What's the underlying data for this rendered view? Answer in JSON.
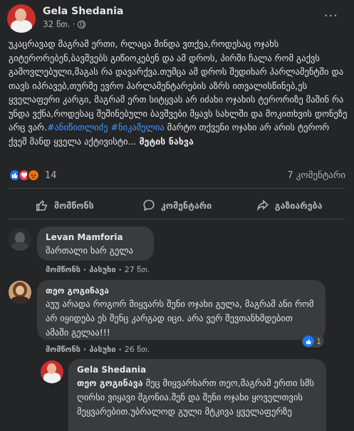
{
  "post": {
    "author": "Gela Shedania",
    "time": "32 წთ.",
    "more_label": "···",
    "text_part1": "უკაცრავად მაგრამ ერთი, რლაცა მინდა ვთქვა,როდესაც ოჯახს გიტერორებენ,ბავშვებს გიწიოკებენ და ამ დროს, პირში ჩალა რომ გაქვს გამოვლებული,მაგას რა დავარქვა.თუმცა ამ დროს შედიხარ პარლამენტში და თავს იპრავებ,თურმე ევრო პარლამენტარების აზრს ითვალისწინებ,ეს ყველაფერი კარგი, მაგრამ ერთ სიტყვას არ იძახი ოჯახის ტერორიზე მაშინ რა უნდა ვქნა,როდესაც შეშინებული ბავშვები მყავს სახლში და მოკითხვის დონეზე არც ვარ.",
    "hashtags": "#ანიწითლიძე #ნიკამელია",
    "text_part2": " მარტო თქვენი ოჯახი არ არის ტერორ ქვეშ მანდ ყველა აქტივისტი...",
    "see_more": "მეტის ნახვა",
    "reaction_count": "14",
    "comment_count": "7 კომენტარი"
  },
  "actions": {
    "like": "მომწონს",
    "comment": "კომენტარი",
    "share": "გაზიარება"
  },
  "comments": [
    {
      "author": "Levan Mamforia",
      "text": "მართალი ხარ გელა",
      "like_label": "მომწონს",
      "reply_label": "პასუხი",
      "time": "27 წთ."
    },
    {
      "author": "თეო გოგინავა",
      "text": "აუუ არადა როგორ მიყვარს შენი ოჯახი გელა, მაგრამ ანი რომ არ იყიდება ეს შენც კარგად იცი. არა ვერ შევთანხმდებით ამაში გელაა!!!",
      "like_label": "მომწონს",
      "reply_label": "პასუხი",
      "time": "26 წთ.",
      "likes": "1"
    },
    {
      "author": "Gela Shedania",
      "mention": "თეო გოგინავა",
      "text": " მეც მიყვარხართ თეო,მაგრამ ერთი სმს ღირსი ვიყავი მგონია.შენ და შენი ოჯახი ყოველთვის მეყვარებით.უბრალოდ გული მტკივა ყველაფერზე"
    }
  ],
  "icons": {
    "like_reaction": "thumbs-up-icon",
    "love_reaction": "heart-icon",
    "angry_reaction": "angry-face-icon",
    "privacy": "globe-icon"
  },
  "colors": {
    "background": "#242526",
    "bubble": "#3a3b3c",
    "link": "#4599ff",
    "like": "#1877f2",
    "love": "#f33e58",
    "angry": "#e9710f"
  }
}
